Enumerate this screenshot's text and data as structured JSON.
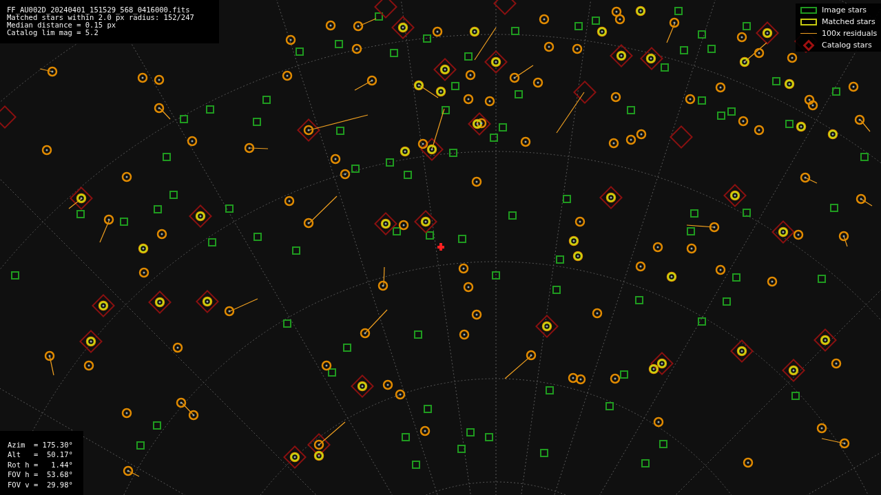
{
  "file_info": {
    "lines": [
      "FF_AU002D_20240401_151529_568_0416000.fits",
      "Matched stars within 2.0 px radius: 152/247",
      "Median distance = 0.15 px",
      "Catalog lim mag = 5.2"
    ]
  },
  "legend": [
    {
      "kind": "square",
      "color": "#1f9a1f",
      "label": "Image stars"
    },
    {
      "kind": "square",
      "color": "#c8cc10",
      "label": "Matched stars"
    },
    {
      "kind": "line",
      "color": "#f0a020",
      "label": "100x residuals"
    },
    {
      "kind": "diamond",
      "color": "#a01010",
      "label": "Catalog stars"
    }
  ],
  "pointing": {
    "lines": [
      "Azim  = 175.30°",
      "Alt   =  50.17°",
      "Rot h =   1.44°",
      "FOV h =  53.68°",
      "FOV v =  29.98°"
    ]
  }
}
